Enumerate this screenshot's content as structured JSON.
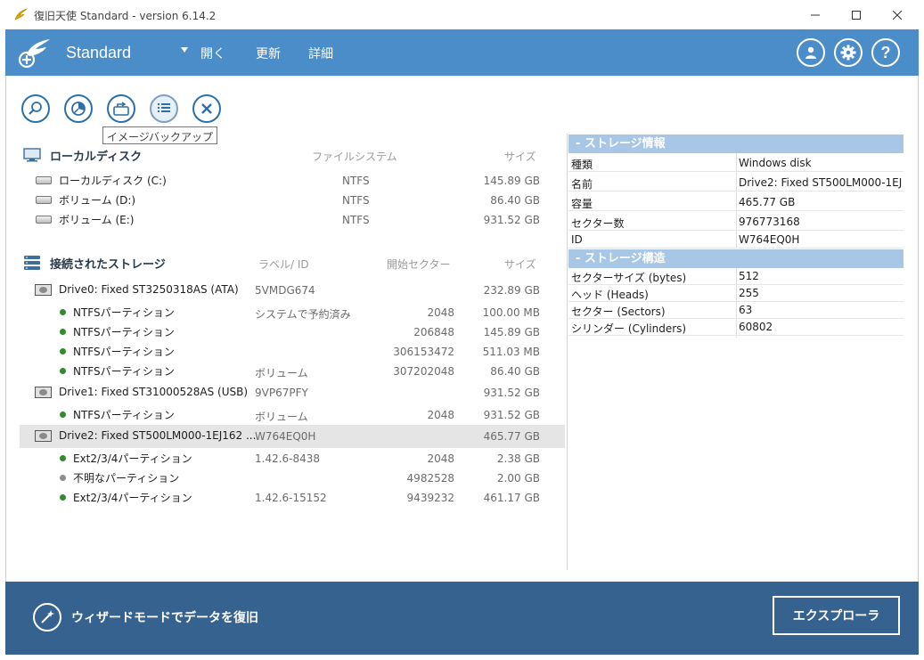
{
  "window": {
    "title": "復旧天使 Standard - version 6.14.2"
  },
  "header": {
    "brand": "Standard",
    "menu": [
      "開く",
      "更新",
      "詳細"
    ]
  },
  "toolbar": {
    "tooltip": "イメージバックアップ"
  },
  "local_disk": {
    "title": "ローカルディスク",
    "col_fs": "ファイルシステム",
    "col_size": "サイズ",
    "rows": [
      {
        "name": "ローカルディスク (C:)",
        "fs": "NTFS",
        "size": "145.89 GB"
      },
      {
        "name": "ボリューム (D:)",
        "fs": "NTFS",
        "size": "86.40 GB"
      },
      {
        "name": "ボリューム (E:)",
        "fs": "NTFS",
        "size": "931.52 GB"
      }
    ]
  },
  "storage": {
    "title": "接続されたストレージ",
    "col_label": "ラベル/ ID",
    "col_start": "開始セクター",
    "col_size": "サイズ",
    "rows": [
      {
        "name": "Drive0: Fixed ST3250318AS (ATA)",
        "label": "5VMDG674",
        "start": "",
        "size": "232.89 GB"
      },
      {
        "name": "NTFSパーティション",
        "label": "システムで予約済み",
        "start": "2048",
        "size": "100.00 MB"
      },
      {
        "name": "NTFSパーティション",
        "label": "",
        "start": "206848",
        "size": "145.89 GB"
      },
      {
        "name": "NTFSパーティション",
        "label": "",
        "start": "306153472",
        "size": "511.03 MB"
      },
      {
        "name": "NTFSパーティション",
        "label": "ボリューム",
        "start": "307202048",
        "size": "86.40 GB"
      },
      {
        "name": "Drive1: Fixed ST31000528AS (USB)",
        "label": "9VP67PFY",
        "start": "",
        "size": "931.52 GB"
      },
      {
        "name": "NTFSパーティション",
        "label": "ボリューム",
        "start": "2048",
        "size": "931.52 GB"
      },
      {
        "name": "Drive2: Fixed ST500LM000-1EJ162 ...",
        "label": "W764EQ0H",
        "start": "",
        "size": "465.77 GB"
      },
      {
        "name": "Ext2/3/4パーティション",
        "label": "1.42.6-8438",
        "start": "2048",
        "size": "2.38 GB"
      },
      {
        "name": "不明なパーティション",
        "label": "",
        "start": "4982528",
        "size": "2.00 GB"
      },
      {
        "name": "Ext2/3/4パーティション",
        "label": "1.42.6-15152",
        "start": "9439232",
        "size": "461.17 GB"
      }
    ]
  },
  "info": {
    "storage_info_title": "-  ストレージ情報",
    "storage_info": [
      {
        "k": "種類",
        "v": "Windows disk"
      },
      {
        "k": "名前",
        "v": "Drive2: Fixed ST500LM000-1EJ1"
      },
      {
        "k": "容量",
        "v": "465.77 GB"
      },
      {
        "k": "セクター数",
        "v": "976773168"
      },
      {
        "k": "ID",
        "v": "W764EQ0H"
      }
    ],
    "storage_struct_title": "-  ストレージ構造",
    "storage_struct": [
      {
        "k": "セクターサイズ (bytes)",
        "v": "512"
      },
      {
        "k": "ヘッド (Heads)",
        "v": "255"
      },
      {
        "k": "セクター (Sectors)",
        "v": "63"
      },
      {
        "k": "シリンダー (Cylinders)",
        "v": "60802"
      }
    ]
  },
  "footer": {
    "wizard_label": "ウィザードモードでデータを復旧",
    "explorer_label": "エクスプローラ"
  },
  "colors": {
    "header": "#4a8dc8",
    "footer": "#36628f",
    "panel_head": "#a8c7e6",
    "dot_green": "#2e8b2e",
    "dot_gray": "#8c8c8c"
  }
}
